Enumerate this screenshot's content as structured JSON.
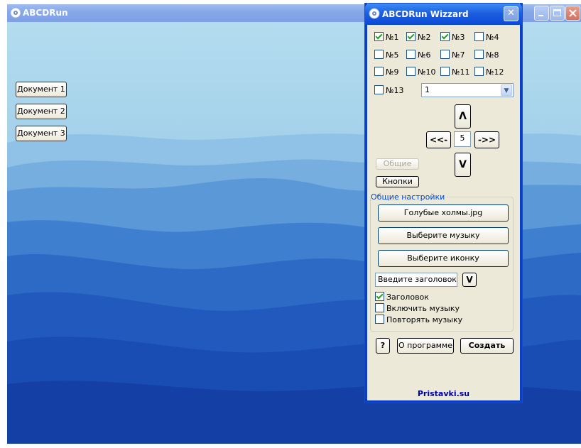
{
  "main_window": {
    "title": "ABCDRun",
    "documents": [
      "Документ 1",
      "Документ 2",
      "Документ 3"
    ]
  },
  "wizard": {
    "title": "ABCDRun Wizzard",
    "close_glyph": "✕",
    "checkboxes": [
      {
        "label": "№1",
        "checked": true
      },
      {
        "label": "№2",
        "checked": true
      },
      {
        "label": "№3",
        "checked": true
      },
      {
        "label": "№4",
        "checked": false
      },
      {
        "label": "№5",
        "checked": false
      },
      {
        "label": "№6",
        "checked": false
      },
      {
        "label": "№7",
        "checked": false
      },
      {
        "label": "№8",
        "checked": false
      },
      {
        "label": "№9",
        "checked": false
      },
      {
        "label": "№10",
        "checked": false
      },
      {
        "label": "№11",
        "checked": false
      },
      {
        "label": "№12",
        "checked": false
      },
      {
        "label": "№13",
        "checked": false
      }
    ],
    "combo_value": "1",
    "nav": {
      "up": "Λ",
      "down": "V",
      "left": "<<-",
      "right": "->>",
      "value": "5"
    },
    "general_button": "Общие",
    "buttons_button": "Кнопки",
    "settings": {
      "group_label": "Общие настройки",
      "file_button": "Голубые холмы.jpg",
      "music_button": "Выберите музыку",
      "icon_button": "Выберите иконку",
      "title_placeholder": "Введите заголовок",
      "v_button": "V",
      "options": [
        {
          "label": "Заголовок",
          "checked": true
        },
        {
          "label": "Включить музыку",
          "checked": false
        },
        {
          "label": "Повторять музыку",
          "checked": false
        }
      ]
    },
    "help_button": "?",
    "about_button": "О программе",
    "create_button": "Создать",
    "footer": "Pristavki.su"
  },
  "colors": {
    "wizard_border": "#0a3fc4",
    "wizard_body": "#ece9d8",
    "sky_top": "#aed7ee",
    "mountains_dark": "#1345b0"
  }
}
